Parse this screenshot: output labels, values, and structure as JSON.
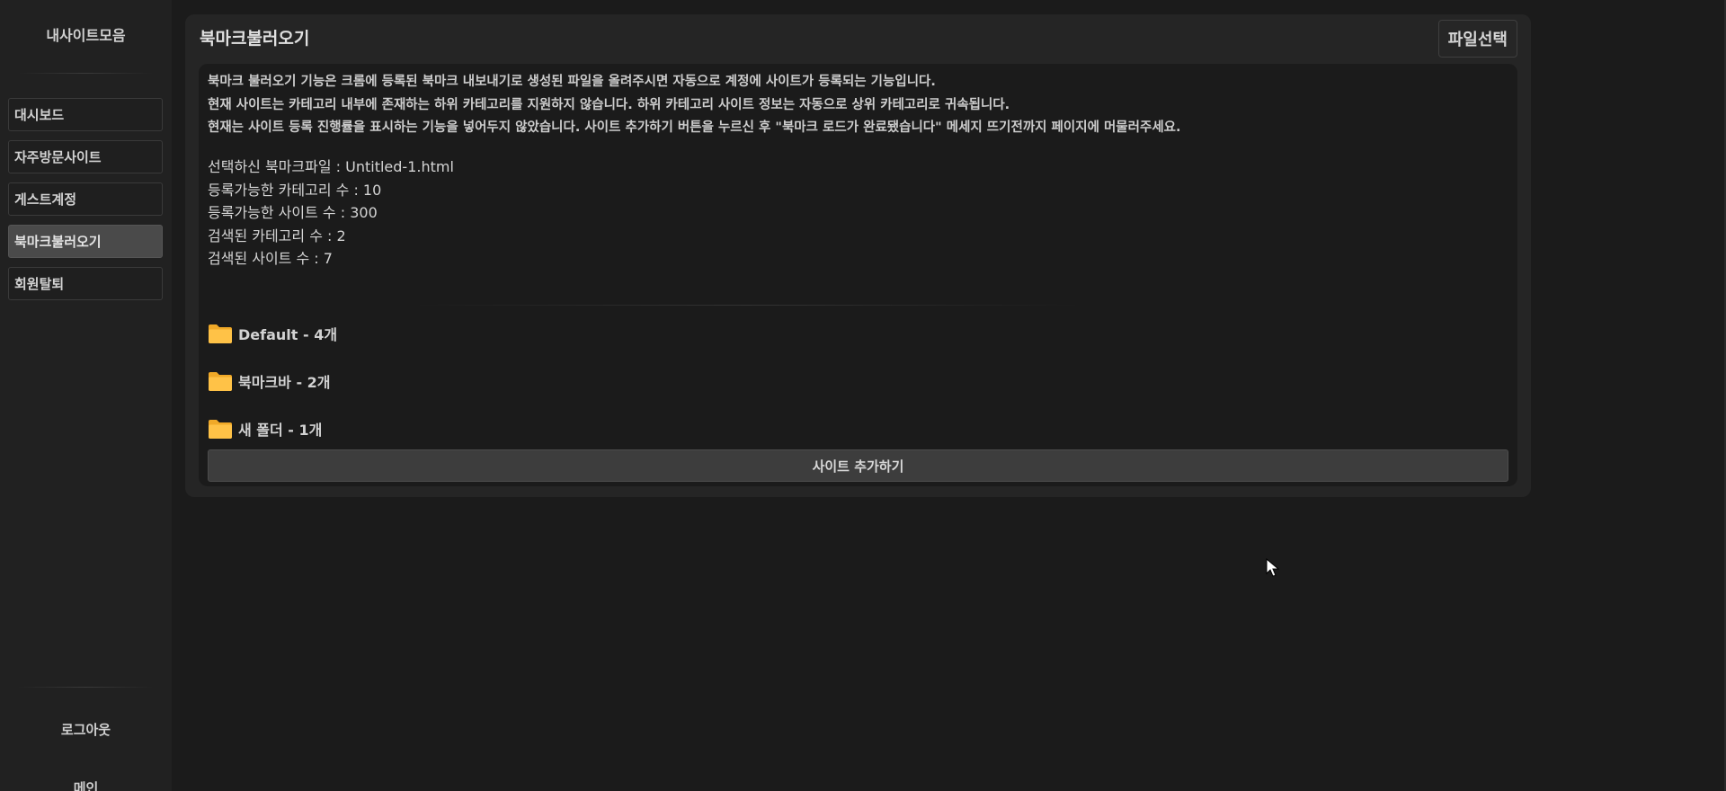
{
  "sidebar": {
    "brand": "내사이트모음",
    "items": [
      {
        "label": "대시보드",
        "active": false
      },
      {
        "label": "자주방문사이트",
        "active": false
      },
      {
        "label": "게스트계정",
        "active": false
      },
      {
        "label": "북마크불러오기",
        "active": true
      },
      {
        "label": "회원탈퇴",
        "active": false
      }
    ],
    "logout_label": "로그아웃",
    "main_label": "메인"
  },
  "panel": {
    "title": "북마크불러오기",
    "file_button_label": "파일선택",
    "notices": [
      "북마크 불러오기 기능은 크롬에 등록된 북마크 내보내기로 생성된 파일을 올려주시면 자동으로 계정에 사이트가 등록되는 기능입니다.",
      "현재 사이트는 카테고리 내부에 존재하는 하위 카테고리를 지원하지 않습니다. 하위 카테고리 사이트 정보는 자동으로 상위 카테고리로 귀속됩니다.",
      "현재는 사이트 등록 진행률을 표시하는 기능을 넣어두지 않았습니다. 사이트 추가하기 버튼을 누르신 후 \"북마크 로드가 완료됐습니다\" 메세지 뜨기전까지 페이지에 머물러주세요."
    ],
    "stats": [
      "선택하신 북마크파일 : Untitled-1.html",
      "등록가능한 카테고리 수 : 10",
      "등록가능한 사이트 수 : 300",
      "검색된 카테고리 수 : 2",
      "검색된 사이트 수 : 7"
    ],
    "folders": [
      {
        "label": "Default - 4개"
      },
      {
        "label": "북마크바 - 2개"
      },
      {
        "label": "새 폴더 - 1개"
      }
    ],
    "add_button_label": "사이트 추가하기"
  },
  "icons": {
    "folder": "folder-icon",
    "cursor": "mouse-pointer-icon"
  },
  "colors": {
    "background": "#1b1b1b",
    "sidebar": "#212121",
    "panel": "#252525",
    "folder": "#f7b731",
    "active_nav": "#4a4a4a"
  }
}
